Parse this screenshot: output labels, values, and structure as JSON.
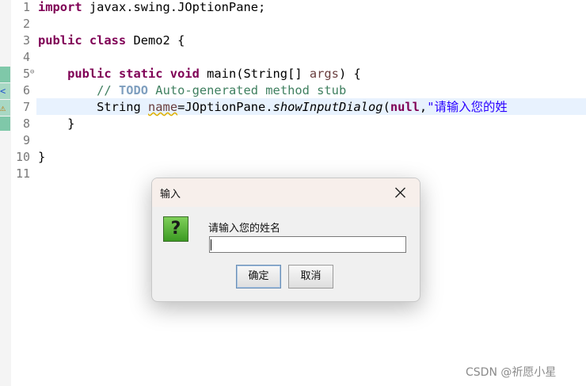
{
  "editor": {
    "line_numbers": [
      "1",
      "2",
      "3",
      "4",
      "5",
      "6",
      "7",
      "8",
      "9",
      "10",
      "11"
    ],
    "line1": {
      "kw": "import",
      "rest": " javax.swing.JOptionPane;"
    },
    "line3": {
      "kw": "public class",
      "rest": " Demo2 {"
    },
    "line5": {
      "indent": "    ",
      "kw": "public static void",
      "rest": " main(String[] ",
      "param": "args",
      "tail": ") {"
    },
    "line6": {
      "indent": "        ",
      "comment_start": "// ",
      "todo": "TODO",
      "comment_rest": " Auto-generated method stub"
    },
    "line7": {
      "indent": "        ",
      "type": "String ",
      "var": "name",
      "eq": "=JOptionPane.",
      "method": "showInputDialog",
      "open": "(",
      "null_kw": "null",
      "comma": ",",
      "str": "\"请输入您的姓"
    },
    "line8": {
      "text": "    }"
    },
    "line10": {
      "text": "}"
    }
  },
  "dialog": {
    "title": "输入",
    "prompt": "请输入您的姓名",
    "icon_glyph": "?",
    "input_value": "",
    "ok_label": "确定",
    "cancel_label": "取消"
  },
  "watermark": "CSDN @祈愿小星",
  "colors": {
    "keyword": "#7f0055",
    "comment": "#3f7f5f",
    "string": "#2a00ff",
    "current_line": "#e8f2fe"
  }
}
